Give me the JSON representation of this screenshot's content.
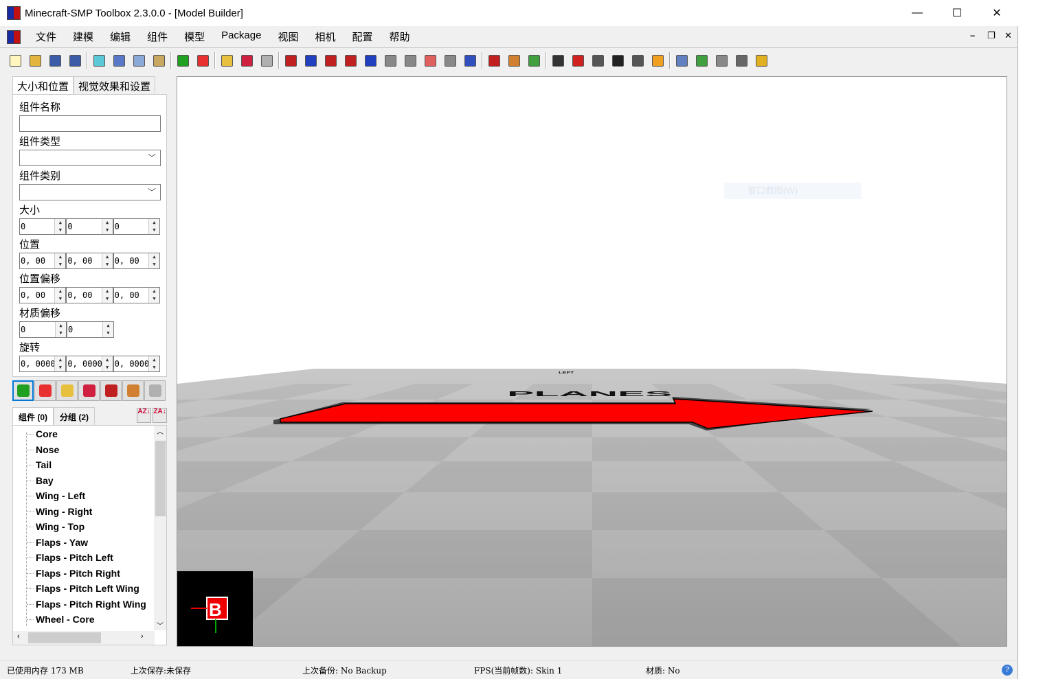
{
  "window": {
    "title": "Minecraft-SMP Toolbox 2.3.0.0 - [Model Builder]",
    "minimize": "—",
    "maximize": "☐",
    "close": "✕"
  },
  "menu": [
    "文件",
    "建模",
    "编辑",
    "组件",
    "模型",
    "Package",
    "视图",
    "相机",
    "配置",
    "帮助"
  ],
  "mdi": {
    "minimize": "–",
    "restore": "❐",
    "close": "✕"
  },
  "toolbar": [
    {
      "icon": "new-icon",
      "color": "#fff6c0"
    },
    {
      "icon": "open-icon",
      "color": "#e3b53c"
    },
    {
      "icon": "save-icon",
      "color": "#3c5ca8"
    },
    {
      "icon": "save-all-icon",
      "color": "#3c5ca8"
    },
    "sep",
    {
      "icon": "document-icon",
      "color": "#5bc8d8"
    },
    {
      "icon": "cut-icon",
      "color": "#5a78c8"
    },
    {
      "icon": "copy-icon",
      "color": "#8aa8d8"
    },
    {
      "icon": "paste-icon",
      "color": "#c8a860"
    },
    "sep",
    {
      "icon": "cube-icon",
      "color": "#20a020"
    },
    {
      "icon": "box-icon",
      "color": "#e83030"
    },
    "sep",
    {
      "icon": "pencil-icon",
      "color": "#e8c040"
    },
    {
      "icon": "group-icon",
      "color": "#d02040"
    },
    {
      "icon": "delete-icon",
      "color": "#b0b0b0"
    },
    "sep",
    {
      "icon": "mirror-x-icon",
      "color": "#c02020"
    },
    {
      "icon": "mirror-y-icon",
      "color": "#2040c0"
    },
    {
      "icon": "mirror-z-icon",
      "color": "#c02020"
    },
    {
      "icon": "rotate-left-icon",
      "color": "#c02020"
    },
    {
      "icon": "rotate-right-icon",
      "color": "#2040c0"
    },
    {
      "icon": "rotate-left-0-icon",
      "color": "#888"
    },
    {
      "icon": "rotate-right-0-icon",
      "color": "#888"
    },
    {
      "icon": "eraser-icon",
      "color": "#e06060"
    },
    {
      "icon": "bounds-icon",
      "color": "#888"
    },
    {
      "icon": "move-icon",
      "color": "#3050c0"
    },
    "sep",
    {
      "icon": "texture-icon",
      "color": "#c02020"
    },
    {
      "icon": "brush-icon",
      "color": "#d08030"
    },
    {
      "icon": "paint-icon",
      "color": "#40a040"
    },
    "sep",
    {
      "icon": "cross-icon",
      "color": "#333"
    },
    {
      "icon": "red-block-icon",
      "color": "#d02020"
    },
    {
      "icon": "boot-icon",
      "color": "#555"
    },
    {
      "icon": "wheel-icon",
      "color": "#222"
    },
    {
      "icon": "camera-icon",
      "color": "#555"
    },
    {
      "icon": "explode-icon",
      "color": "#f0a020"
    },
    "sep",
    {
      "icon": "list-icon",
      "color": "#6080c0"
    },
    {
      "icon": "checklist-icon",
      "color": "#40a040"
    },
    {
      "icon": "settings-icon",
      "color": "#888"
    },
    {
      "icon": "robot-icon",
      "color": "#666"
    },
    {
      "icon": "shield-icon",
      "color": "#e0b020"
    }
  ],
  "panel": {
    "tabs": [
      "大小和位置",
      "视觉效果和设置"
    ],
    "name_label": "组件名称",
    "name_value": "",
    "type_label": "组件类型",
    "type_value": "",
    "category_label": "组件类别",
    "category_value": "",
    "size_label": "大小",
    "size": [
      "0",
      "0",
      "0"
    ],
    "position_label": "位置",
    "position": [
      "0, 00",
      "0, 00",
      "0, 00"
    ],
    "offset_label": "位置偏移",
    "offset": [
      "0, 00",
      "0, 00",
      "0, 00"
    ],
    "texture_offset_label": "材质偏移",
    "texture_offset": [
      "0",
      "0"
    ],
    "rotation_label": "旋转",
    "rotation": [
      "0, 0000",
      "0, 0000",
      "0, 0000"
    ]
  },
  "buttons": [
    {
      "icon": "cube-icon",
      "color": "#20a020"
    },
    {
      "icon": "box-icon",
      "color": "#e83030"
    },
    {
      "icon": "pencil-icon",
      "color": "#e8c040"
    },
    {
      "icon": "group-icon",
      "color": "#d02040"
    },
    {
      "icon": "texture-icon",
      "color": "#c02020"
    },
    {
      "icon": "brush-icon",
      "color": "#d08030"
    },
    {
      "icon": "delete-icon",
      "color": "#b0b0b0"
    }
  ],
  "tree": {
    "tabs": [
      "组件 (0)",
      "分组 (2)"
    ],
    "sort_az": "AZ↓",
    "sort_za": "ZA↓",
    "items": [
      "Core",
      "Nose",
      "Tail",
      "Bay",
      "Wing - Left",
      "Wing - Right",
      "Wing - Top",
      "Flaps - Yaw",
      "Flaps - Pitch Left",
      "Flaps - Pitch Right",
      "Flaps - Pitch Left Wing",
      "Flaps - Pitch Right Wing",
      "Wheel - Core"
    ]
  },
  "viewport": {
    "floor_labels": [
      "PLANES",
      "LEFT"
    ],
    "arrow_color": "#ff0000",
    "ghost_menu": "窗口截图(W)",
    "axis_label": "B"
  },
  "status": {
    "memory": "已使用内存 173 MB",
    "last_save": "上次保存:未保存",
    "last_backup": "上次备份: No Backup",
    "fps": "FPS(当前帧数): Skin 1",
    "texture": "材质: No",
    "help": "?"
  }
}
